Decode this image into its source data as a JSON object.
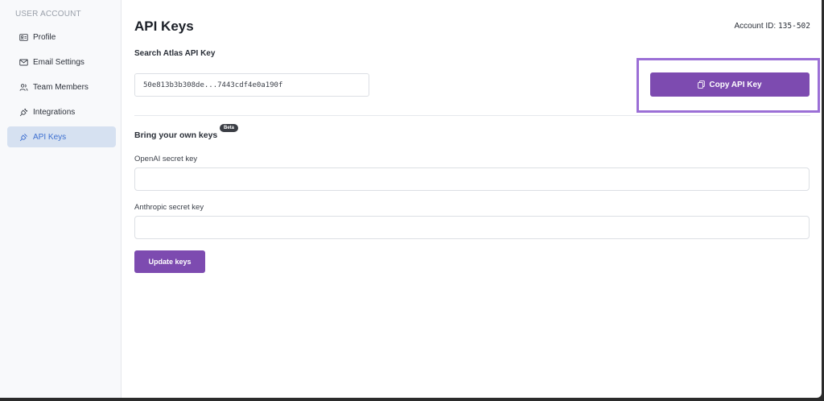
{
  "sidebar": {
    "heading": "USER ACCOUNT",
    "items": [
      {
        "label": "Profile",
        "icon": "id-card-icon"
      },
      {
        "label": "Email Settings",
        "icon": "envelope-icon"
      },
      {
        "label": "Team Members",
        "icon": "users-icon"
      },
      {
        "label": "Integrations",
        "icon": "plug-icon"
      },
      {
        "label": "API Keys",
        "icon": "key-icon",
        "active": true
      }
    ]
  },
  "header": {
    "title": "API Keys",
    "account_label": "Account ID:",
    "account_id": "135-502"
  },
  "atlas": {
    "label": "Search Atlas API Key",
    "key_value": "50e813b3b308de...7443cdf4e0a190f",
    "copy_label": "Copy API Key"
  },
  "byok": {
    "label": "Bring your own keys",
    "badge": "Beta",
    "openai_label": "OpenAI secret key",
    "openai_value": "",
    "anthropic_label": "Anthropic secret key",
    "anthropic_value": "",
    "update_label": "Update keys"
  },
  "colors": {
    "accent": "#7d4bb0",
    "highlight": "#9b6fd6",
    "active_nav_bg": "#d6e1f1",
    "active_nav_text": "#3d6fd0"
  }
}
